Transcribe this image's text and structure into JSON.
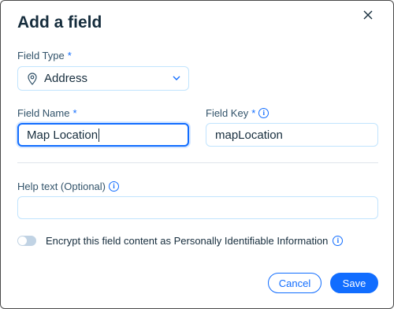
{
  "dialog": {
    "title": "Add a field"
  },
  "field_type": {
    "label": "Field Type",
    "required_mark": "*",
    "value": "Address",
    "icon": "location-pin-icon"
  },
  "field_name": {
    "label": "Field Name",
    "required_mark": "*",
    "value": "Map Location"
  },
  "field_key": {
    "label": "Field Key",
    "required_mark": "*",
    "value": "mapLocation"
  },
  "help_text": {
    "label": "Help text (Optional)",
    "value": ""
  },
  "encrypt": {
    "label": "Encrypt this field content as Personally Identifiable Information",
    "enabled": false
  },
  "actions": {
    "cancel_label": "Cancel",
    "save_label": "Save"
  },
  "info_glyph": "i",
  "colors": {
    "accent": "#116dff",
    "text": "#162d3d",
    "border": "#c1e4fe"
  }
}
